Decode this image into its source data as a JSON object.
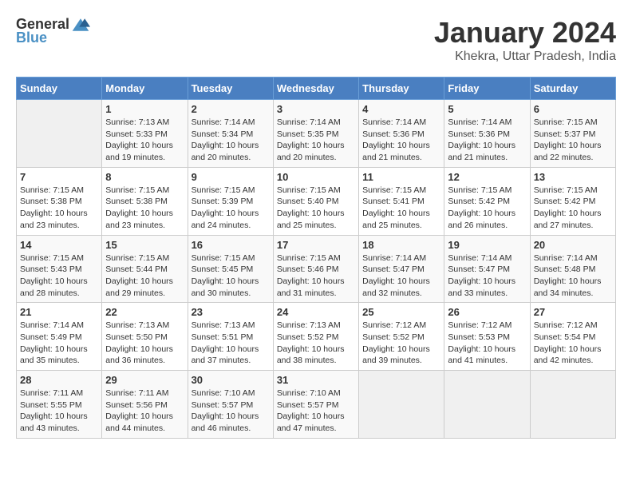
{
  "header": {
    "logo_general": "General",
    "logo_blue": "Blue",
    "title": "January 2024",
    "location": "Khekra, Uttar Pradesh, India"
  },
  "calendar": {
    "columns": [
      "Sunday",
      "Monday",
      "Tuesday",
      "Wednesday",
      "Thursday",
      "Friday",
      "Saturday"
    ],
    "weeks": [
      [
        {
          "day": "",
          "info": ""
        },
        {
          "day": "1",
          "info": "Sunrise: 7:13 AM\nSunset: 5:33 PM\nDaylight: 10 hours\nand 19 minutes."
        },
        {
          "day": "2",
          "info": "Sunrise: 7:14 AM\nSunset: 5:34 PM\nDaylight: 10 hours\nand 20 minutes."
        },
        {
          "day": "3",
          "info": "Sunrise: 7:14 AM\nSunset: 5:35 PM\nDaylight: 10 hours\nand 20 minutes."
        },
        {
          "day": "4",
          "info": "Sunrise: 7:14 AM\nSunset: 5:36 PM\nDaylight: 10 hours\nand 21 minutes."
        },
        {
          "day": "5",
          "info": "Sunrise: 7:14 AM\nSunset: 5:36 PM\nDaylight: 10 hours\nand 21 minutes."
        },
        {
          "day": "6",
          "info": "Sunrise: 7:15 AM\nSunset: 5:37 PM\nDaylight: 10 hours\nand 22 minutes."
        }
      ],
      [
        {
          "day": "7",
          "info": "Sunrise: 7:15 AM\nSunset: 5:38 PM\nDaylight: 10 hours\nand 23 minutes."
        },
        {
          "day": "8",
          "info": "Sunrise: 7:15 AM\nSunset: 5:38 PM\nDaylight: 10 hours\nand 23 minutes."
        },
        {
          "day": "9",
          "info": "Sunrise: 7:15 AM\nSunset: 5:39 PM\nDaylight: 10 hours\nand 24 minutes."
        },
        {
          "day": "10",
          "info": "Sunrise: 7:15 AM\nSunset: 5:40 PM\nDaylight: 10 hours\nand 25 minutes."
        },
        {
          "day": "11",
          "info": "Sunrise: 7:15 AM\nSunset: 5:41 PM\nDaylight: 10 hours\nand 25 minutes."
        },
        {
          "day": "12",
          "info": "Sunrise: 7:15 AM\nSunset: 5:42 PM\nDaylight: 10 hours\nand 26 minutes."
        },
        {
          "day": "13",
          "info": "Sunrise: 7:15 AM\nSunset: 5:42 PM\nDaylight: 10 hours\nand 27 minutes."
        }
      ],
      [
        {
          "day": "14",
          "info": "Sunrise: 7:15 AM\nSunset: 5:43 PM\nDaylight: 10 hours\nand 28 minutes."
        },
        {
          "day": "15",
          "info": "Sunrise: 7:15 AM\nSunset: 5:44 PM\nDaylight: 10 hours\nand 29 minutes."
        },
        {
          "day": "16",
          "info": "Sunrise: 7:15 AM\nSunset: 5:45 PM\nDaylight: 10 hours\nand 30 minutes."
        },
        {
          "day": "17",
          "info": "Sunrise: 7:15 AM\nSunset: 5:46 PM\nDaylight: 10 hours\nand 31 minutes."
        },
        {
          "day": "18",
          "info": "Sunrise: 7:14 AM\nSunset: 5:47 PM\nDaylight: 10 hours\nand 32 minutes."
        },
        {
          "day": "19",
          "info": "Sunrise: 7:14 AM\nSunset: 5:47 PM\nDaylight: 10 hours\nand 33 minutes."
        },
        {
          "day": "20",
          "info": "Sunrise: 7:14 AM\nSunset: 5:48 PM\nDaylight: 10 hours\nand 34 minutes."
        }
      ],
      [
        {
          "day": "21",
          "info": "Sunrise: 7:14 AM\nSunset: 5:49 PM\nDaylight: 10 hours\nand 35 minutes."
        },
        {
          "day": "22",
          "info": "Sunrise: 7:13 AM\nSunset: 5:50 PM\nDaylight: 10 hours\nand 36 minutes."
        },
        {
          "day": "23",
          "info": "Sunrise: 7:13 AM\nSunset: 5:51 PM\nDaylight: 10 hours\nand 37 minutes."
        },
        {
          "day": "24",
          "info": "Sunrise: 7:13 AM\nSunset: 5:52 PM\nDaylight: 10 hours\nand 38 minutes."
        },
        {
          "day": "25",
          "info": "Sunrise: 7:12 AM\nSunset: 5:52 PM\nDaylight: 10 hours\nand 39 minutes."
        },
        {
          "day": "26",
          "info": "Sunrise: 7:12 AM\nSunset: 5:53 PM\nDaylight: 10 hours\nand 41 minutes."
        },
        {
          "day": "27",
          "info": "Sunrise: 7:12 AM\nSunset: 5:54 PM\nDaylight: 10 hours\nand 42 minutes."
        }
      ],
      [
        {
          "day": "28",
          "info": "Sunrise: 7:11 AM\nSunset: 5:55 PM\nDaylight: 10 hours\nand 43 minutes."
        },
        {
          "day": "29",
          "info": "Sunrise: 7:11 AM\nSunset: 5:56 PM\nDaylight: 10 hours\nand 44 minutes."
        },
        {
          "day": "30",
          "info": "Sunrise: 7:10 AM\nSunset: 5:57 PM\nDaylight: 10 hours\nand 46 minutes."
        },
        {
          "day": "31",
          "info": "Sunrise: 7:10 AM\nSunset: 5:57 PM\nDaylight: 10 hours\nand 47 minutes."
        },
        {
          "day": "",
          "info": ""
        },
        {
          "day": "",
          "info": ""
        },
        {
          "day": "",
          "info": ""
        }
      ]
    ]
  }
}
